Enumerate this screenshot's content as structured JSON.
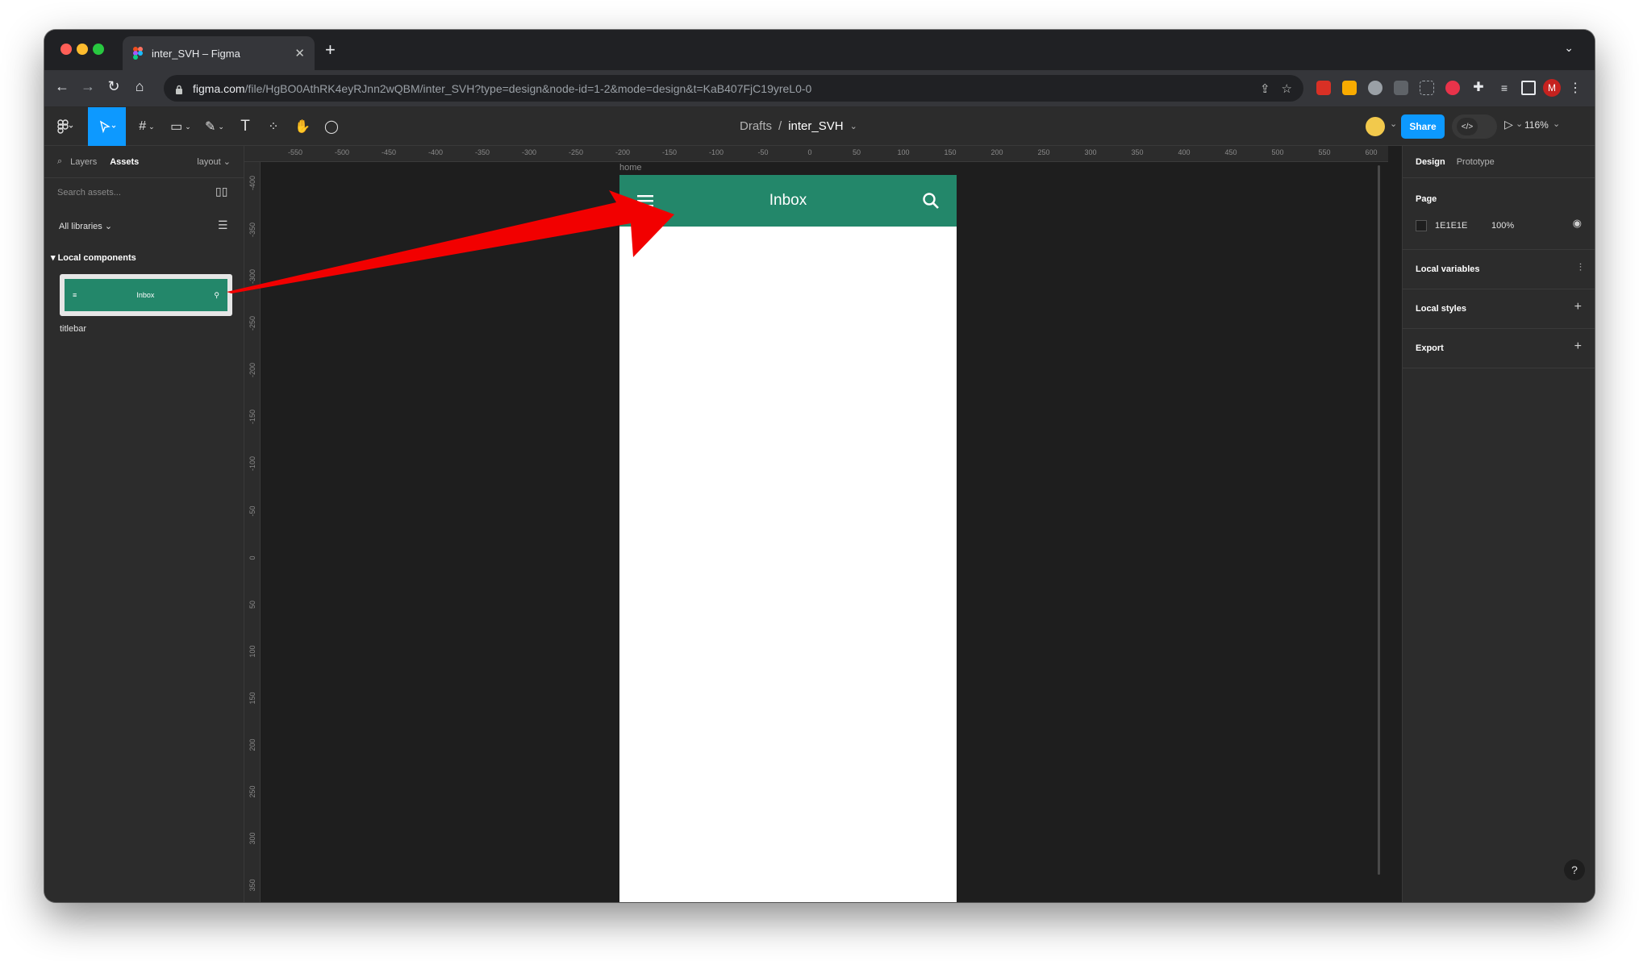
{
  "browser": {
    "tab_title": "inter_SVH – Figma",
    "url_host": "figma.com",
    "url_path": "/file/HgBO0AthRK4eyRJnn2wQBM/inter_SVH?type=design&node-id=1-2&mode=design&t=KaB407FjC19yreL0-0",
    "profile_initial": "M"
  },
  "toolbar": {
    "breadcrumb_root": "Drafts",
    "breadcrumb_sep": "/",
    "file_name": "inter_SVH",
    "share_label": "Share",
    "zoom_label": "116%"
  },
  "left_panel": {
    "tabs": {
      "layers": "Layers",
      "assets": "Assets",
      "layout": "layout"
    },
    "search_placeholder": "Search assets...",
    "libraries_label": "All libraries",
    "local_components_label": "Local components",
    "component_name": "titlebar",
    "thumb_title": "Inbox"
  },
  "canvas": {
    "ruler_x": [
      "-550",
      "-500",
      "-450",
      "-400",
      "-350",
      "-300",
      "-250",
      "-200",
      "-150",
      "-100",
      "-50",
      "0",
      "50",
      "100",
      "150",
      "200",
      "250",
      "300",
      "350",
      "400",
      "450",
      "500",
      "550",
      "600"
    ],
    "ruler_y": [
      "-400",
      "-350",
      "-300",
      "-250",
      "-200",
      "-150",
      "-100",
      "-50",
      "0",
      "50",
      "100",
      "150",
      "200",
      "250",
      "300",
      "350"
    ],
    "frame_name": "home",
    "appbar_title": "Inbox"
  },
  "right_panel": {
    "tabs": {
      "design": "Design",
      "prototype": "Prototype"
    },
    "page_label": "Page",
    "page_color": "1E1E1E",
    "page_opacity": "100%",
    "local_variables": "Local variables",
    "local_styles": "Local styles",
    "export": "Export",
    "help": "?"
  },
  "colors": {
    "appbar": "#23876A",
    "figma_blue": "#0D99FF",
    "annotation_arrow": "#F20000",
    "canvas_bg": "#1E1E1E"
  }
}
